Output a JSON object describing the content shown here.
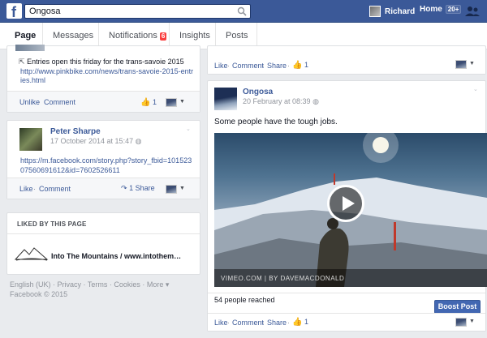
{
  "topbar": {
    "search_value": "Ongosa",
    "user_name": "Richard",
    "home_label": "Home",
    "home_badge": "20+"
  },
  "tabs": [
    {
      "label": "Page"
    },
    {
      "label": "Messages"
    },
    {
      "label": "Notifications",
      "badge": "6"
    },
    {
      "label": "Insights"
    },
    {
      "label": "Posts"
    }
  ],
  "left_post1": {
    "entry_text": "Entries open this friday for the trans-savoie 2015",
    "link": "http://www.pinkbike.com/news/trans-savoie-2015-entries.html",
    "unlike": "Unlike",
    "comment": "Comment",
    "like_count": "1"
  },
  "left_post2": {
    "author": "Peter Sharpe",
    "time": "17 October 2014 at 15:47",
    "link": "https://m.facebook.com/story.php?story_fbid=10152307560691612&id=7602526611",
    "like": "Like",
    "comment": "Comment",
    "share": "1 Share"
  },
  "liked": {
    "title": "LIKED BY THIS PAGE",
    "page_name": "Into The Mountains / www.intothem…"
  },
  "footer": {
    "links": "English (UK) · Privacy · Terms · Cookies · More ▾",
    "copyright": "Facebook © 2015"
  },
  "right_top": {
    "like": "Like",
    "comment": "Comment",
    "share": "Share",
    "like_count": "1"
  },
  "right_post": {
    "author": "Ongosa",
    "time": "20 February at 08:39",
    "text": "Some people have the tough jobs.",
    "video_credit": "VIMEO.COM   |   BY DAVEMACDONALD",
    "reached": "54 people reached",
    "boost": "Boost Post",
    "like": "Like",
    "comment": "Comment",
    "share": "Share",
    "like_count": "1"
  }
}
